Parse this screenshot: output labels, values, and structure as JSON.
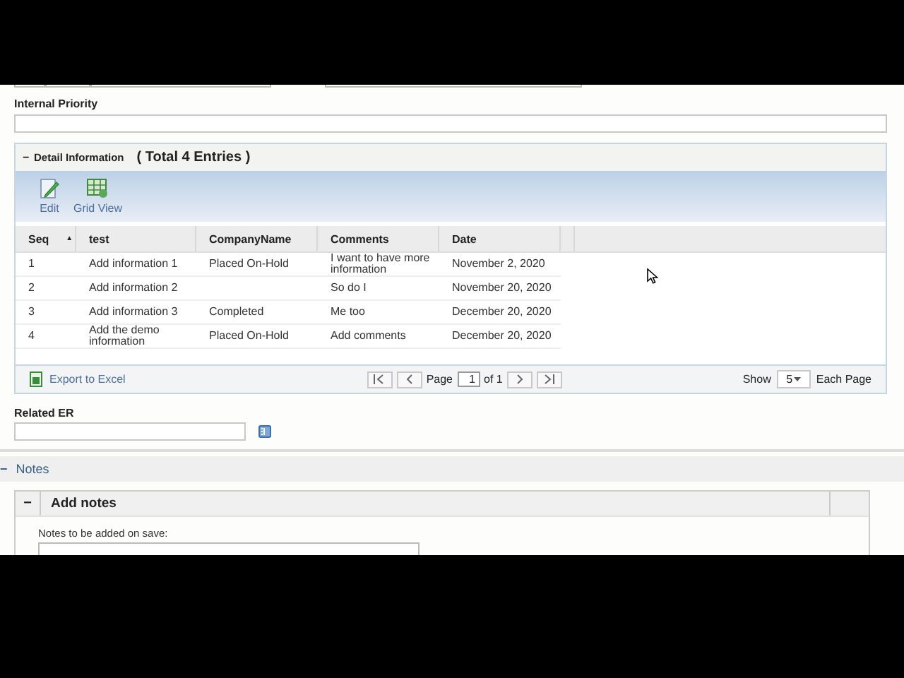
{
  "internal_priority": {
    "label": "Internal Priority"
  },
  "detail_panel": {
    "expanded": true,
    "toggle": "−",
    "title": "Detail Information",
    "total": "( Total 4 Entries )",
    "toolbar": [
      {
        "kind": "edit",
        "label": "Edit"
      },
      {
        "kind": "grid",
        "label": "Grid View"
      }
    ],
    "table": {
      "columns": [
        {
          "label": "Seq",
          "sort": "▲"
        },
        {
          "label": "test"
        },
        {
          "label": "CompanyName"
        },
        {
          "label": "Comments"
        },
        {
          "label": "Date"
        }
      ],
      "rows": [
        [
          "1",
          "Add information 1",
          "Placed On-Hold",
          "I want to have more information",
          "November 2, 2020"
        ],
        [
          "2",
          "Add information 2",
          "",
          "So do I",
          "November 20, 2020"
        ],
        [
          "3",
          "Add information 3",
          "Completed",
          "Me too",
          "December 20, 2020"
        ],
        [
          "4",
          "Add the demo information",
          "Placed On-Hold",
          "Add comments",
          "December 20, 2020"
        ]
      ]
    },
    "footer": {
      "export": "Export to Excel",
      "page_label": "Page",
      "page": "1",
      "of": "of 1",
      "show": "Show",
      "page_size": "5",
      "each_page": "Each Page"
    }
  },
  "related_er": {
    "label": "Related ER"
  },
  "notes": {
    "expanded": true,
    "toggle": "−",
    "title": "Notes",
    "add_notes": {
      "expanded": true,
      "toggle": "−",
      "title": "Add notes",
      "field_label": "Notes to be added on save:"
    }
  }
}
